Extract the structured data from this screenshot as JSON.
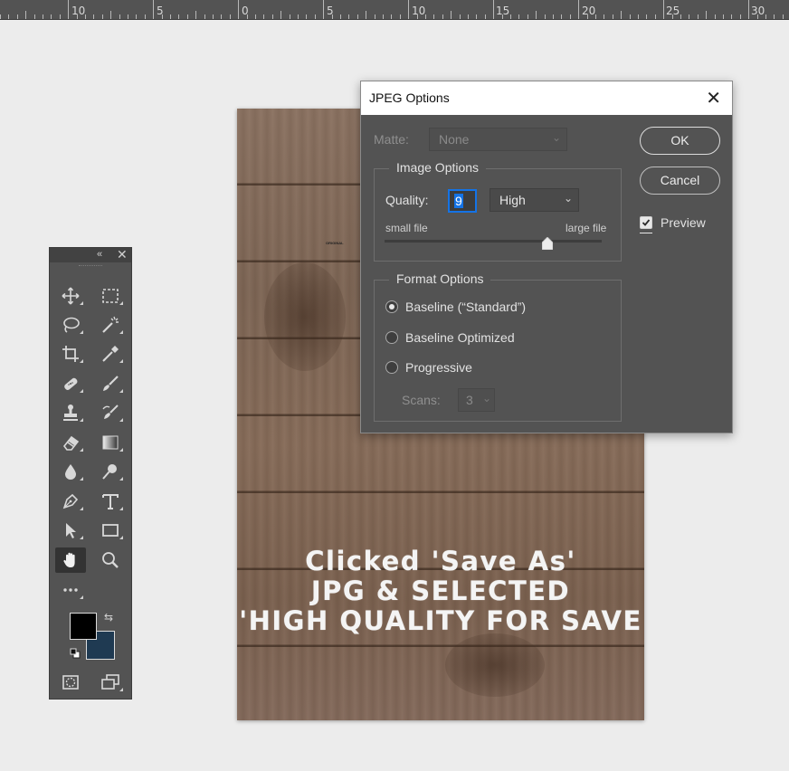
{
  "ruler": {
    "labels": [
      "10",
      "5",
      "0",
      "5",
      "10",
      "15",
      "20",
      "25",
      "30"
    ]
  },
  "canvas": {
    "caption_lines": [
      "Clicked 'Save As'",
      "JPG & SELECTED",
      "'HIGH QUALITY FOR SAVE"
    ],
    "tiny_text": "ORIGINAL"
  },
  "tools_panel": {
    "collapse_glyph": "«",
    "close_glyph": "✕",
    "tools": [
      "move-tool",
      "marquee-tool",
      "lasso-tool",
      "magic-wand-tool",
      "crop-tool",
      "eyedropper-tool",
      "healing-brush-tool",
      "brush-tool",
      "clone-stamp-tool",
      "history-brush-tool",
      "eraser-tool",
      "gradient-tool",
      "blur-tool",
      "dodge-tool",
      "pen-tool",
      "type-tool",
      "path-selection-tool",
      "rectangle-tool",
      "hand-tool",
      "zoom-tool",
      "more-tools"
    ],
    "active_tool": "hand-tool",
    "foreground_color": "#000000",
    "background_color": "#1f3a52"
  },
  "dialog": {
    "title": "JPEG Options",
    "close_glyph": "✕",
    "matte": {
      "label": "Matte:",
      "value": "None"
    },
    "image_options": {
      "legend": "Image Options",
      "quality_label": "Quality:",
      "quality_value": "9",
      "quality_preset": "High",
      "small_label": "small file",
      "large_label": "large file",
      "slider_fraction": 0.75
    },
    "format_options": {
      "legend": "Format Options",
      "options": [
        {
          "label": "Baseline (“Standard”)",
          "selected": true
        },
        {
          "label": "Baseline Optimized",
          "selected": false
        },
        {
          "label": "Progressive",
          "selected": false
        }
      ],
      "scans_label": "Scans:",
      "scans_value": "3"
    },
    "ok_label": "OK",
    "cancel_label": "Cancel",
    "preview_label": "Preview",
    "preview_checked": true
  }
}
